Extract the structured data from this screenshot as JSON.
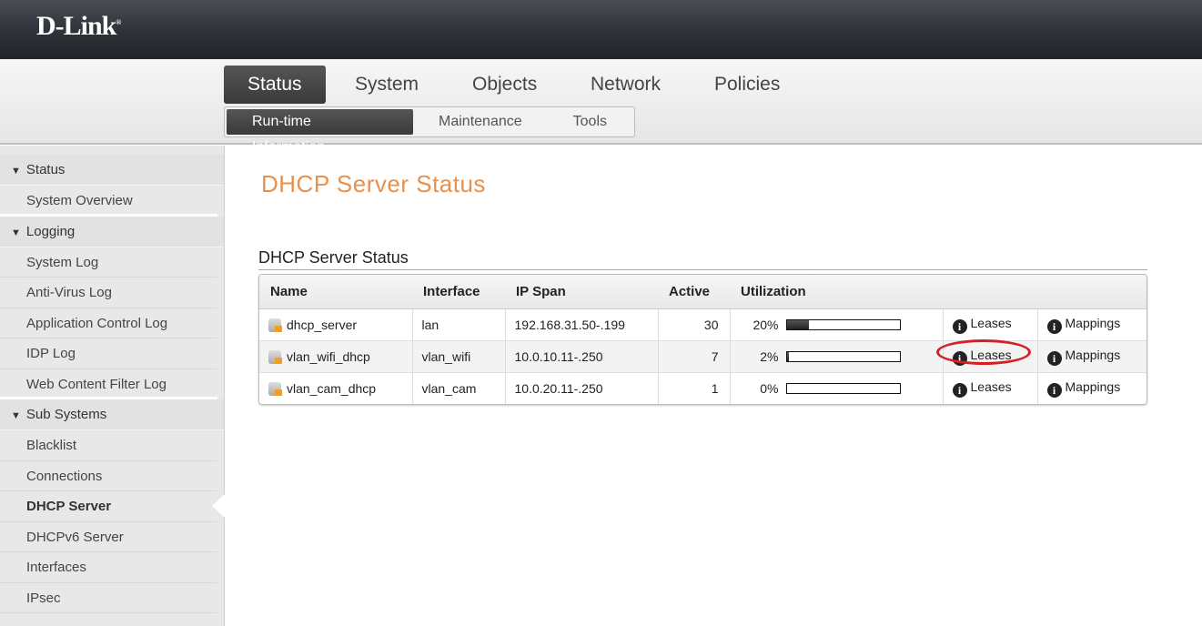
{
  "brand": {
    "logo": "D-Link"
  },
  "top_tabs": [
    {
      "label": "Status",
      "active": true
    },
    {
      "label": "System"
    },
    {
      "label": "Objects"
    },
    {
      "label": "Network"
    },
    {
      "label": "Policies"
    }
  ],
  "sub_tabs": [
    {
      "label": "Run-time Information",
      "active": true
    },
    {
      "label": "Maintenance"
    },
    {
      "label": "Tools"
    }
  ],
  "sidebar": {
    "status": {
      "label": "Status",
      "items": [
        "System Overview"
      ]
    },
    "logging": {
      "label": "Logging",
      "items": [
        "System Log",
        "Anti-Virus Log",
        "Application Control Log",
        "IDP Log",
        "Web Content Filter Log"
      ]
    },
    "sub_systems": {
      "label": "Sub Systems",
      "items": [
        "Blacklist",
        "Connections",
        "DHCP Server",
        "DHCPv6 Server",
        "Interfaces",
        "IPsec"
      ],
      "selected": "DHCP Server"
    }
  },
  "page_title": "DHCP Server Status",
  "section_title": "DHCP Server Status",
  "table": {
    "headers": [
      "Name",
      "Interface",
      "IP Span",
      "Active",
      "Utilization"
    ],
    "rows": [
      {
        "name": "dhcp_server",
        "interface": "lan",
        "ip_span": "192.168.31.50-.199",
        "active": "30",
        "util_label": "20%",
        "util": 20,
        "leases": "Leases",
        "mappings": "Mappings"
      },
      {
        "name": "vlan_wifi_dhcp",
        "interface": "vlan_wifi",
        "ip_span": "10.0.10.11-.250",
        "active": "7",
        "util_label": "2%",
        "util": 2,
        "leases": "Leases",
        "mappings": "Mappings",
        "highlighted": true
      },
      {
        "name": "vlan_cam_dhcp",
        "interface": "vlan_cam",
        "ip_span": "10.0.20.11-.250",
        "active": "1",
        "util_label": "0%",
        "util": 0,
        "leases": "Leases",
        "mappings": "Mappings"
      }
    ]
  },
  "colors": {
    "title": "#e9904c",
    "highlight": "#d81e25"
  }
}
